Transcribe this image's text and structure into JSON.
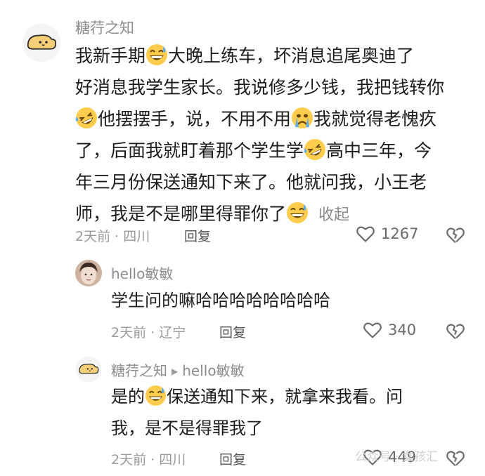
{
  "comment1": {
    "username": "糖荇之知",
    "avatar_icon": "cartoon-bread-avatar",
    "lines": [
      "我新手期",
      "大晚上练车，坏消息追尾奥迪了",
      "好消息我学生家长。我说修多少钱，我把钱转你",
      "他摆摆手，说，不用不用",
      "我就觉得老愧疚",
      "了，后面我就盯着那个学生学",
      "高中三年，今",
      "年三月份保送通知下来了。他就问我，小王老",
      "师，我是不是哪里得罪你了",
      "收起"
    ],
    "meta": "2天前 · 四川",
    "reply_label": "回复",
    "like_count": "1267"
  },
  "reply1": {
    "username": "hello敏敏",
    "avatar_icon": "girl-photo-avatar",
    "text": "学生问的嘛哈哈哈哈哈哈哈哈",
    "meta": "2天前 · 辽宁",
    "reply_label": "回复",
    "like_count": "340"
  },
  "reply2": {
    "username": "糖荇之知",
    "reply_to": "hello敏敏",
    "avatar_icon": "cartoon-bread-avatar",
    "lines": [
      "是的",
      "保送通知下来，就拿来我看。问",
      "我，是不是得罪我了"
    ],
    "meta": "2天前 · 四川",
    "reply_label": "回复",
    "like_count": "449"
  },
  "watermark": "公众号 · 女孩汇",
  "icons": {
    "like": "heart-outline-icon",
    "dislike": "broken-heart-icon",
    "laugh_emoji": "grinning-sweat-emoji",
    "cry_laugh_emoji": "rolling-laugh-emoji",
    "cry_emoji": "crying-emoji"
  }
}
